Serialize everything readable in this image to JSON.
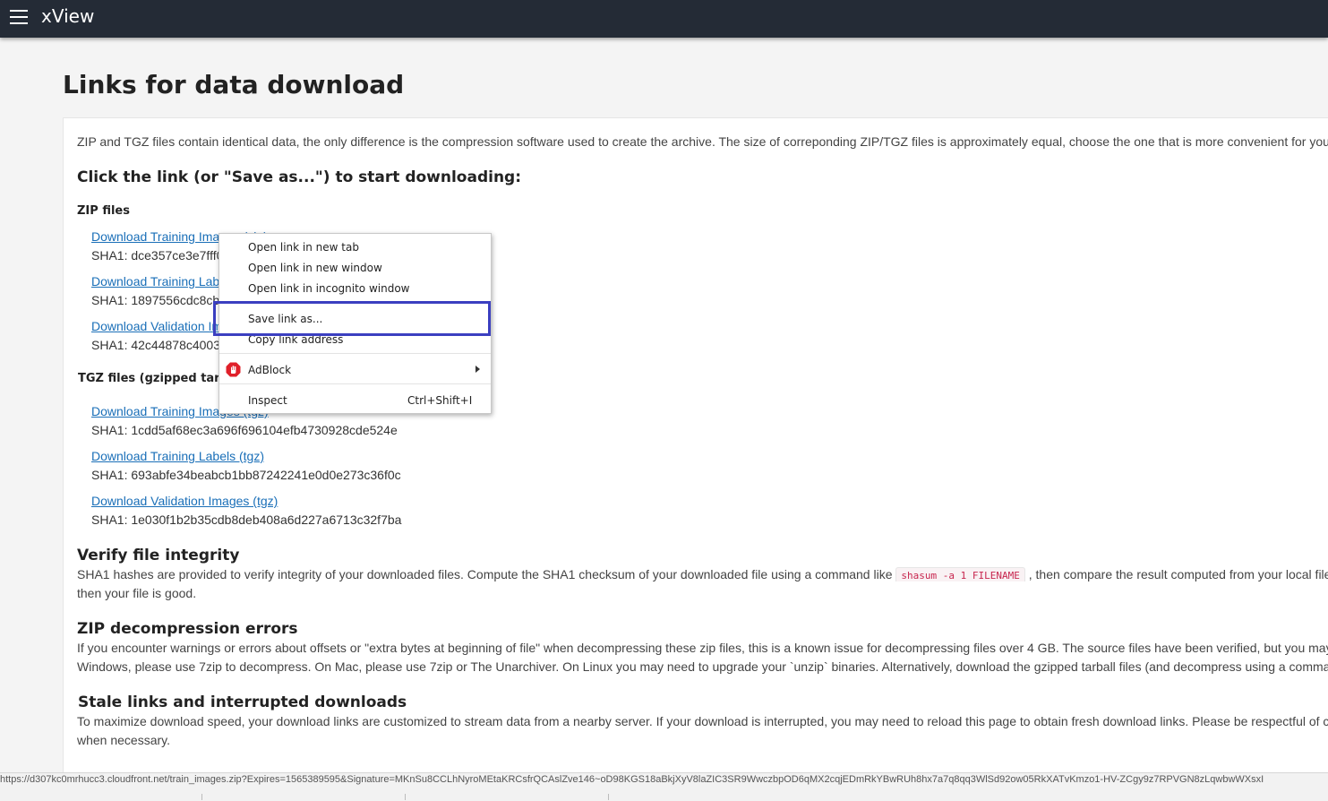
{
  "app": {
    "title": "xView"
  },
  "page": {
    "title": "Links for data download"
  },
  "content": {
    "intro": "ZIP and TGZ files contain identical data, the only difference is the compression software used to create the archive. The size of correponding ZIP/TGZ files is approximately equal, choose the one that is more convenient for you",
    "click_heading": "Click the link (or \"Save as...\") to start downloading:",
    "zip_heading": "ZIP files",
    "zip_items": [
      {
        "link": "Download Training Images (zip)",
        "sha": "SHA1: dce357ce3e7fff0"
      },
      {
        "link": "Download Training Labels (zip)",
        "sha": "SHA1: 1897556cdc8cb"
      },
      {
        "link": "Download Validation Images (zip)",
        "sha": "SHA1: 42c44878c4003"
      }
    ],
    "tgz_heading": "TGZ files (gzipped tarballs)",
    "tgz_items": [
      {
        "link": "Download Training Images (tgz)",
        "sha": "SHA1: 1cdd5af68ec3a696f696104efb4730928cde524e"
      },
      {
        "link": "Download Training Labels (tgz)",
        "sha": "SHA1: 693abfe34beabcb1bb87242241e0d0e273c36f0c"
      },
      {
        "link": "Download Validation Images (tgz)",
        "sha": "SHA1: 1e030f1b2b35cdb8deb408a6d227a6713c32f7ba"
      }
    ],
    "verify": {
      "heading": "Verify file integrity",
      "text_before": "SHA1 hashes are provided to verify integrity of your downloaded files. Compute the SHA1 checksum of your downloaded file using a command like",
      "code": "shasum -a 1 FILENAME",
      "text_after": ", then compare the result computed from your local file",
      "line2": "then your file is good."
    },
    "zip_errors": {
      "heading": "ZIP decompression errors",
      "line1": "If you encounter warnings or errors about offsets or \"extra bytes at beginning of file\" when decompressing these zip files, this is a known issue for decompressing files over 4 GB. The source files have been verified, but you may",
      "line2": "Windows, please use 7zip to decompress. On Mac, please use 7zip or The Unarchiver. On Linux you may need to upgrade your `unzip` binaries. Alternatively, download the gzipped tarball files (and decompress using a comma"
    },
    "stale": {
      "heading": "Stale links and interrupted downloads",
      "line1": "To maximize download speed, your download links are customized to stream data from a nearby server. If your download is interrupted, you may need to reload this page to obtain fresh download links. Please be respectful of c",
      "line2": "when necessary."
    }
  },
  "context_menu": {
    "open_new_tab": "Open link in new tab",
    "open_new_window": "Open link in new window",
    "open_incognito": "Open link in incognito window",
    "save_link_as": "Save link as...",
    "copy_link_address": "Copy link address",
    "adblock": "AdBlock",
    "inspect": "Inspect",
    "inspect_shortcut": "Ctrl+Shift+I"
  },
  "status_url": "https://d307kc0mrhucc3.cloudfront.net/train_images.zip?Expires=1565389595&Signature=MKnSu8CCLhNyroMEtaKRCsfrQCAslZve146~oD98KGS18aBkjXyV8laZIC3SR9WwczbpOD6qMX2cqjEDmRkYBwRUh8hx7a7q8qq3WlSd92ow05RkXATvKmzo1-HV-ZCgy9z7RPVGN8zLqwbwWXsxI",
  "colors": {
    "appbar": "#242b36",
    "link": "#1a6fb8",
    "highlight": "#3b3fc0",
    "code": "#c7254e"
  },
  "icons": {
    "menu": "hamburger-icon",
    "adblock": "adblock-icon",
    "submenu": "chevron-right-icon"
  }
}
